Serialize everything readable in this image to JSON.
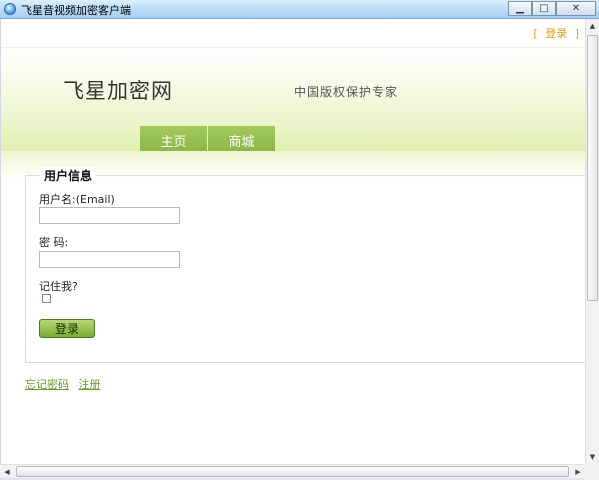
{
  "window": {
    "title": "飞星音视频加密客户端",
    "minimize_icon": "minimize-icon",
    "maximize_icon": "maximize-icon",
    "close_icon": "close-icon",
    "minimize_glyph": "▁",
    "maximize_glyph": "□",
    "close_glyph": "✕"
  },
  "topbar": {
    "bracket_open": "[",
    "login_link": "登录",
    "bracket_close": "]",
    "link_color": "#e39b12"
  },
  "header": {
    "site_title": "飞星加密网",
    "slogan": "中国版权保护专家"
  },
  "nav": {
    "tabs": [
      {
        "label": "主页"
      },
      {
        "label": "商城"
      }
    ],
    "tab_color": "#8bb647"
  },
  "login_form": {
    "legend": "用户信息",
    "username_label": "用户名:(Email)",
    "username_value": "",
    "password_label": "密  码:",
    "password_value": "",
    "remember_label": "记住我?",
    "remember_checked": false,
    "submit_label": "登录"
  },
  "footer": {
    "forgot_password": "忘记密码",
    "register": "注册"
  },
  "scrollbars": {
    "up_glyph": "▲",
    "down_glyph": "▼",
    "left_glyph": "◀",
    "right_glyph": "▶"
  }
}
